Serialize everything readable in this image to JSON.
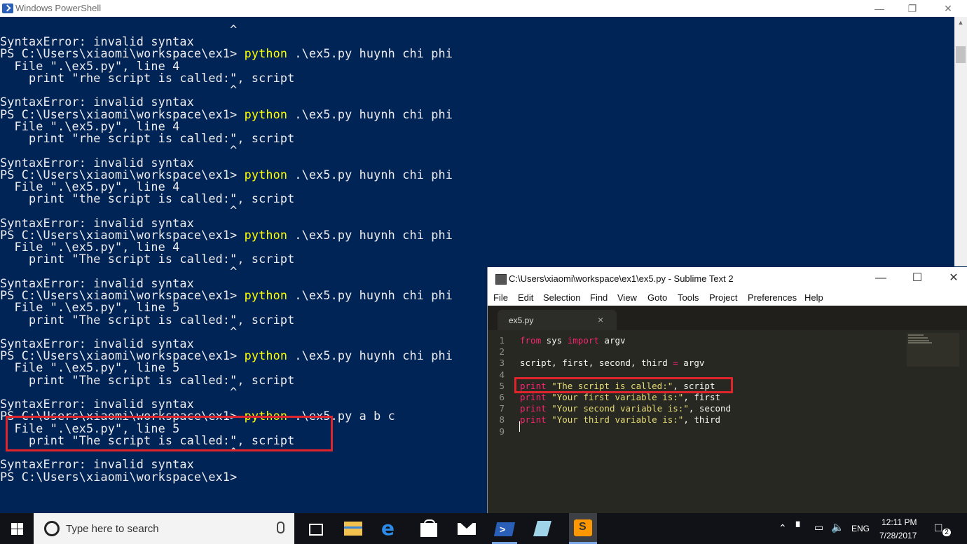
{
  "powershell": {
    "title": "Windows PowerShell",
    "lines": [
      {
        "text": "                                ^"
      },
      {
        "text": "SyntaxError: invalid syntax"
      },
      {
        "prompt": "PS C:\\Users\\xiaomi\\workspace\\ex1> ",
        "cmd": "python",
        "args": " .\\ex5.py huynh chi phi"
      },
      {
        "text": "  File \".\\ex5.py\", line 4"
      },
      {
        "text": "    print \"rhe script is called:\", script"
      },
      {
        "text": "                                ^"
      },
      {
        "text": "SyntaxError: invalid syntax"
      },
      {
        "prompt": "PS C:\\Users\\xiaomi\\workspace\\ex1> ",
        "cmd": "python",
        "args": " .\\ex5.py huynh chi phi"
      },
      {
        "text": "  File \".\\ex5.py\", line 4"
      },
      {
        "text": "    print \"rhe script is called:\", script"
      },
      {
        "text": "                                ^"
      },
      {
        "text": "SyntaxError: invalid syntax"
      },
      {
        "prompt": "PS C:\\Users\\xiaomi\\workspace\\ex1> ",
        "cmd": "python",
        "args": " .\\ex5.py huynh chi phi"
      },
      {
        "text": "  File \".\\ex5.py\", line 4"
      },
      {
        "text": "    print \"the script is called:\", script"
      },
      {
        "text": "                                ^"
      },
      {
        "text": "SyntaxError: invalid syntax"
      },
      {
        "prompt": "PS C:\\Users\\xiaomi\\workspace\\ex1> ",
        "cmd": "python",
        "args": " .\\ex5.py huynh chi phi"
      },
      {
        "text": "  File \".\\ex5.py\", line 4"
      },
      {
        "text": "    print \"The script is called:\", script"
      },
      {
        "text": "                                ^"
      },
      {
        "text": "SyntaxError: invalid syntax"
      },
      {
        "prompt": "PS C:\\Users\\xiaomi\\workspace\\ex1> ",
        "cmd": "python",
        "args": " .\\ex5.py huynh chi phi"
      },
      {
        "text": "  File \".\\ex5.py\", line 5"
      },
      {
        "text": "    print \"The script is called:\", script"
      },
      {
        "text": "                                ^"
      },
      {
        "text": "SyntaxError: invalid syntax"
      },
      {
        "prompt": "PS C:\\Users\\xiaomi\\workspace\\ex1> ",
        "cmd": "python",
        "args": " .\\ex5.py huynh chi phi"
      },
      {
        "text": "  File \".\\ex5.py\", line 5"
      },
      {
        "text": "    print \"The script is called:\", script"
      },
      {
        "text": "                                ^"
      },
      {
        "text": "SyntaxError: invalid syntax"
      },
      {
        "prompt": "PS C:\\Users\\xiaomi\\workspace\\ex1> ",
        "cmd": "python",
        "args": " .\\ex5.py a b c"
      },
      {
        "text": "  File \".\\ex5.py\", line 5"
      },
      {
        "text": "    print \"The script is called:\", script"
      },
      {
        "text": "                                ^"
      },
      {
        "text": "SyntaxError: invalid syntax"
      },
      {
        "prompt": "PS C:\\Users\\xiaomi\\workspace\\ex1> "
      }
    ]
  },
  "sublime": {
    "title": "C:\\Users\\xiaomi\\workspace\\ex1\\ex5.py - Sublime Text 2",
    "menu": [
      "File",
      "Edit",
      "Selection",
      "Find",
      "View",
      "Goto",
      "Tools",
      "Project",
      "Preferences",
      "Help"
    ],
    "tab_name": "ex5.py",
    "tab_close": "×",
    "line_numbers": [
      "1",
      "2",
      "3",
      "4",
      "5",
      "6",
      "7",
      "8",
      "9"
    ],
    "code": [
      [
        {
          "t": "from",
          "c": "kw"
        },
        {
          "t": " sys ",
          "c": ""
        },
        {
          "t": "import",
          "c": "kw"
        },
        {
          "t": " argv",
          "c": ""
        }
      ],
      [],
      [
        {
          "t": "script, first, second, third ",
          "c": ""
        },
        {
          "t": "=",
          "c": "kw"
        },
        {
          "t": " argv",
          "c": ""
        }
      ],
      [],
      [
        {
          "t": "print",
          "c": "kw"
        },
        {
          "t": " ",
          "c": ""
        },
        {
          "t": "\"The script is called:\"",
          "c": "str"
        },
        {
          "t": ", script",
          "c": ""
        }
      ],
      [
        {
          "t": "print",
          "c": "kw"
        },
        {
          "t": " ",
          "c": ""
        },
        {
          "t": "\"Your first variable is:\"",
          "c": "str"
        },
        {
          "t": ", first",
          "c": ""
        }
      ],
      [
        {
          "t": "print",
          "c": "kw"
        },
        {
          "t": " ",
          "c": ""
        },
        {
          "t": "\"Your second variable is:\"",
          "c": "str"
        },
        {
          "t": ", second",
          "c": ""
        }
      ],
      [
        {
          "t": "print",
          "c": "kw"
        },
        {
          "t": " ",
          "c": ""
        },
        {
          "t": "\"Your third variable is:\"",
          "c": "str"
        },
        {
          "t": ", third",
          "c": ""
        }
      ],
      []
    ]
  },
  "taskbar": {
    "search_placeholder": "Type here to search",
    "language": "ENG",
    "time": "12:11 PM",
    "date": "7/28/2017",
    "notification_count": "2"
  },
  "colors": {
    "ps_background": "#012456",
    "ps_command": "#ffff00",
    "highlight_box": "#e0242b",
    "sublime_keyword": "#f92672",
    "sublime_string": "#e6db74"
  }
}
